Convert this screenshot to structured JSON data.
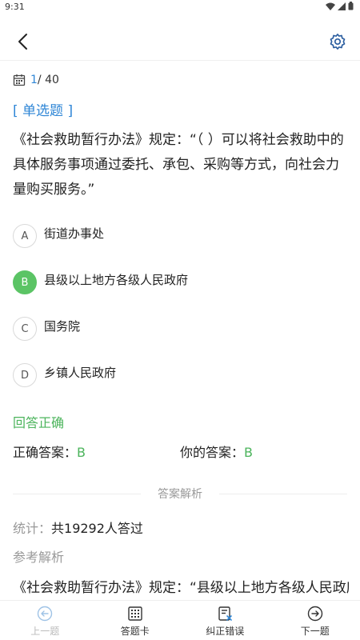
{
  "status_bar": {
    "time": "9:31"
  },
  "progress": {
    "current": "1",
    "total": "/ 40"
  },
  "question_type": "[ 单选题 ]",
  "question_text": "《社会救助暂行办法》规定：“（ ）可以将社会救助中的具体服务事项通过委托、承包、采购等方式，向社会力量购买服务。”",
  "options": [
    {
      "letter": "A",
      "text": "街道办事处",
      "selected": false
    },
    {
      "letter": "B",
      "text": "县级以上地方各级人民政府",
      "selected": true
    },
    {
      "letter": "C",
      "text": "国务院",
      "selected": false
    },
    {
      "letter": "D",
      "text": "乡镇人民政府",
      "selected": false
    }
  ],
  "result_text": "回答正确",
  "answers": {
    "correct_label": "正确答案：",
    "correct_value": "B",
    "yours_label": "你的答案：",
    "yours_value": "B"
  },
  "analysis_divider": "答案解析",
  "stats": {
    "label": "统计：",
    "value": "共19292人答过"
  },
  "reference_title": "参考解析",
  "reference_text": "《社会救助暂行办法》规定：“县级以上地方各级人民政府",
  "bottom_nav": [
    {
      "label": "上一题",
      "icon": "prev-icon",
      "enabled": false
    },
    {
      "label": "答题卡",
      "icon": "answer-card-icon",
      "enabled": true
    },
    {
      "label": "纠正错误",
      "icon": "report-error-icon",
      "enabled": true
    },
    {
      "label": "下一题",
      "icon": "next-icon",
      "enabled": true
    }
  ],
  "colors": {
    "accent_blue": "#2f86d6",
    "correct_green": "#4cb45c",
    "selected_green": "#5bc465",
    "muted": "#999999"
  }
}
